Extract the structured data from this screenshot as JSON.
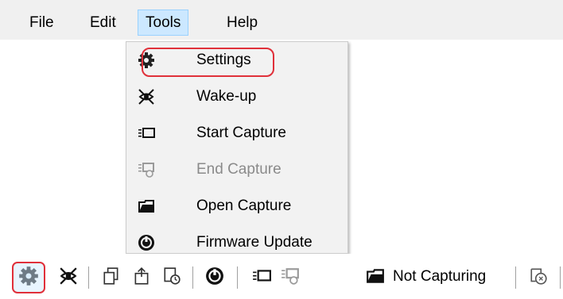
{
  "menubar": {
    "items": [
      {
        "label": "File"
      },
      {
        "label": "Edit"
      },
      {
        "label": "Tools",
        "active": true
      },
      {
        "label": "Help"
      }
    ]
  },
  "tools_menu": {
    "items": [
      {
        "label": "Settings",
        "icon": "gear-icon",
        "enabled": true,
        "highlighted": true
      },
      {
        "label": "Wake-up",
        "icon": "wake-up-icon",
        "enabled": true
      },
      {
        "label": "Start Capture",
        "icon": "start-capture-icon",
        "enabled": true
      },
      {
        "label": "End Capture",
        "icon": "end-capture-icon",
        "enabled": false
      },
      {
        "label": "Open Capture",
        "icon": "open-capture-icon",
        "enabled": true
      },
      {
        "label": "Firmware Update",
        "icon": "firmware-update-icon",
        "enabled": true
      }
    ]
  },
  "toolbar": {
    "buttons": [
      {
        "icon": "gear-icon",
        "highlighted": true
      },
      {
        "icon": "wake-up-icon"
      },
      {
        "icon": "copy-out-icon"
      },
      {
        "icon": "copy-in-icon"
      },
      {
        "icon": "schedule-icon"
      },
      {
        "icon": "firmware-update-icon"
      },
      {
        "icon": "start-capture-icon"
      },
      {
        "icon": "end-capture-icon",
        "enabled": false
      },
      {
        "icon": "open-capture-icon"
      },
      {
        "icon": "capture-status-icon"
      }
    ],
    "status_text": "Not Capturing"
  },
  "colors": {
    "menubar_bg": "#f0f0f0",
    "menu_bg": "#f2f2f2",
    "active_menu_bg": "#cce8ff",
    "highlight_ring": "#e0303a",
    "disabled_text": "#8a8a8a"
  }
}
